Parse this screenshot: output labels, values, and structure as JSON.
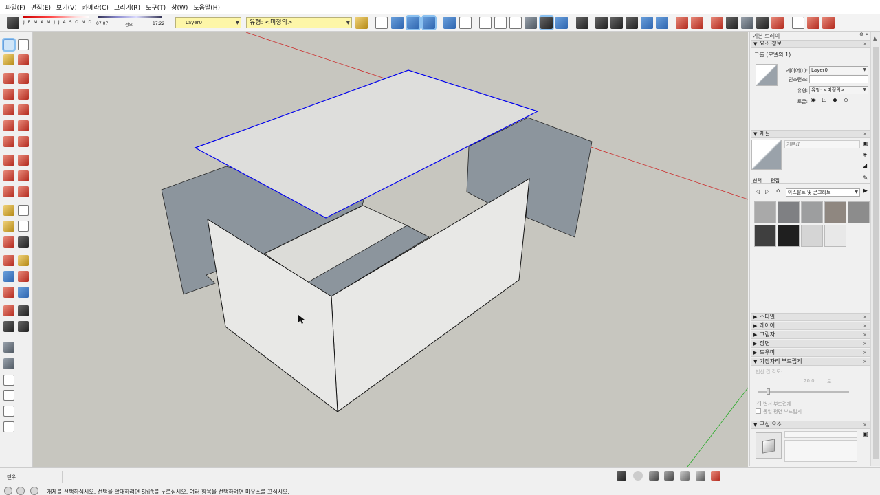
{
  "menu": {
    "items": [
      "파일(F)",
      "편집(E)",
      "보기(V)",
      "카메라(C)",
      "그리기(R)",
      "도구(T)",
      "창(W)",
      "도움말(H)"
    ]
  },
  "toolbar": {
    "shadow": {
      "months": "J F M A M J J A S O N D",
      "time_start": "07:07",
      "time_noon": "정오",
      "time_end": "17:22"
    },
    "layer_value": "Layer0",
    "type_value": "유형: <미정의>"
  },
  "tray": {
    "title": "기본 트레이",
    "entity_info": {
      "header": "요소 정보",
      "object_name": "그룹 (모델의 1)",
      "layer_label": "레이어(L):",
      "layer_value": "Layer0",
      "instance_label": "인스턴스:",
      "instance_value": "",
      "type_label": "유형:",
      "type_value": "유형: <미정의>",
      "toggle_label": "토글:"
    },
    "materials": {
      "header": "재질",
      "default_name": "기본값",
      "tab_select": "선택",
      "tab_edit": "편집",
      "library": "아스팔트 및 콘크리트",
      "swatch_colors": [
        "#a9a9a9",
        "#7f8083",
        "#9d9e9f",
        "#8f8780",
        "#8c8c8c",
        "#3f3f3f",
        "#1f1f1f",
        "#d5d5d5",
        "#e8e8e8"
      ]
    },
    "collapsed_sections": [
      "스타일",
      "레이어",
      "그림자",
      "장면",
      "도우미"
    ],
    "soften": {
      "header": "가장자리 부드럽게",
      "angle_label": "법선 간 각도:",
      "angle_value": "20.0",
      "angle_unit": "도",
      "option_smooth": "법선 부드럽게",
      "option_coplanar": "동일 평면 부드럽게"
    },
    "components": {
      "header": "구성 요소"
    }
  },
  "status": {
    "measurements_label": "단위",
    "message": "개체를 선택하십시오. 선택을 확대하려면 Shift를 누르십시오. 여러 항목을 선택하려면 마우스를 끄십시오."
  },
  "colors": {
    "viewport_bg": "#c7c6bf",
    "face_light": "#e8e8e6",
    "face_dark": "#8c959d",
    "selection_blue": "#0000ee",
    "axis_red": "#cc2a2a",
    "axis_green": "#22aa22"
  }
}
